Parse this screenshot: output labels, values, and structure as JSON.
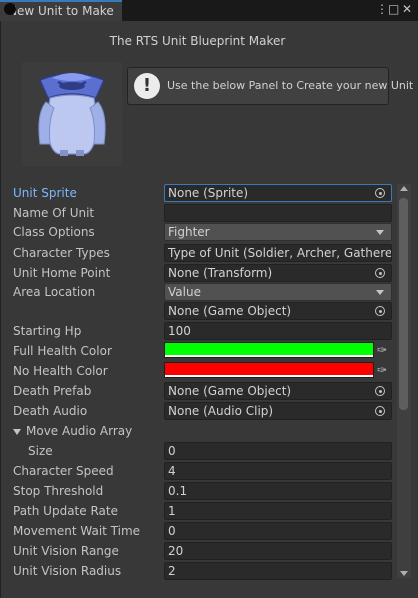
{
  "tab": {
    "title": "New Unit to Make"
  },
  "window": {
    "title": "The RTS Unit Blueprint Maker",
    "help_text": "Use the below Panel to Create your new Unit",
    "help_icon": "!"
  },
  "fields": {
    "unit_sprite": {
      "label": "Unit Sprite",
      "value": "None (Sprite)"
    },
    "name_of_unit": {
      "label": "Name Of Unit",
      "value": ""
    },
    "class_options": {
      "label": "Class Options",
      "value": "Fighter"
    },
    "character_types": {
      "label": "Character Types",
      "value": "Type of Unit (Soldier, Archer, Gatherer, H"
    },
    "unit_home_point": {
      "label": "Unit Home Point",
      "value": "None (Transform)"
    },
    "area_location": {
      "label": "Area Location",
      "value": "Value",
      "object": "None (Game Object)"
    },
    "starting_hp": {
      "label": "Starting Hp",
      "value": "100"
    },
    "full_health_color": {
      "label": "Full Health Color",
      "color": "#00ff00"
    },
    "no_health_color": {
      "label": "No Health Color",
      "color": "#ff0000"
    },
    "death_prefab": {
      "label": "Death Prefab",
      "value": "None (Game Object)"
    },
    "death_audio": {
      "label": "Death Audio",
      "value": "None (Audio Clip)"
    },
    "move_audio_array": {
      "label": "Move Audio Array",
      "size_label": "Size",
      "size": "0"
    },
    "character_speed": {
      "label": "Character Speed",
      "value": "4"
    },
    "stop_threshold": {
      "label": "Stop Threshold",
      "value": "0.1"
    },
    "path_update_rate": {
      "label": "Path Update Rate",
      "value": "1"
    },
    "movement_wait_time": {
      "label": "Movement Wait Time",
      "value": "0"
    },
    "unit_vision_range": {
      "label": "Unit Vision Range",
      "value": "20"
    },
    "unit_vision_radius": {
      "label": "Unit Vision Radius",
      "value": "2"
    }
  },
  "colors": {
    "accent": "#3a79bb",
    "active_label": "#7db8ff"
  }
}
